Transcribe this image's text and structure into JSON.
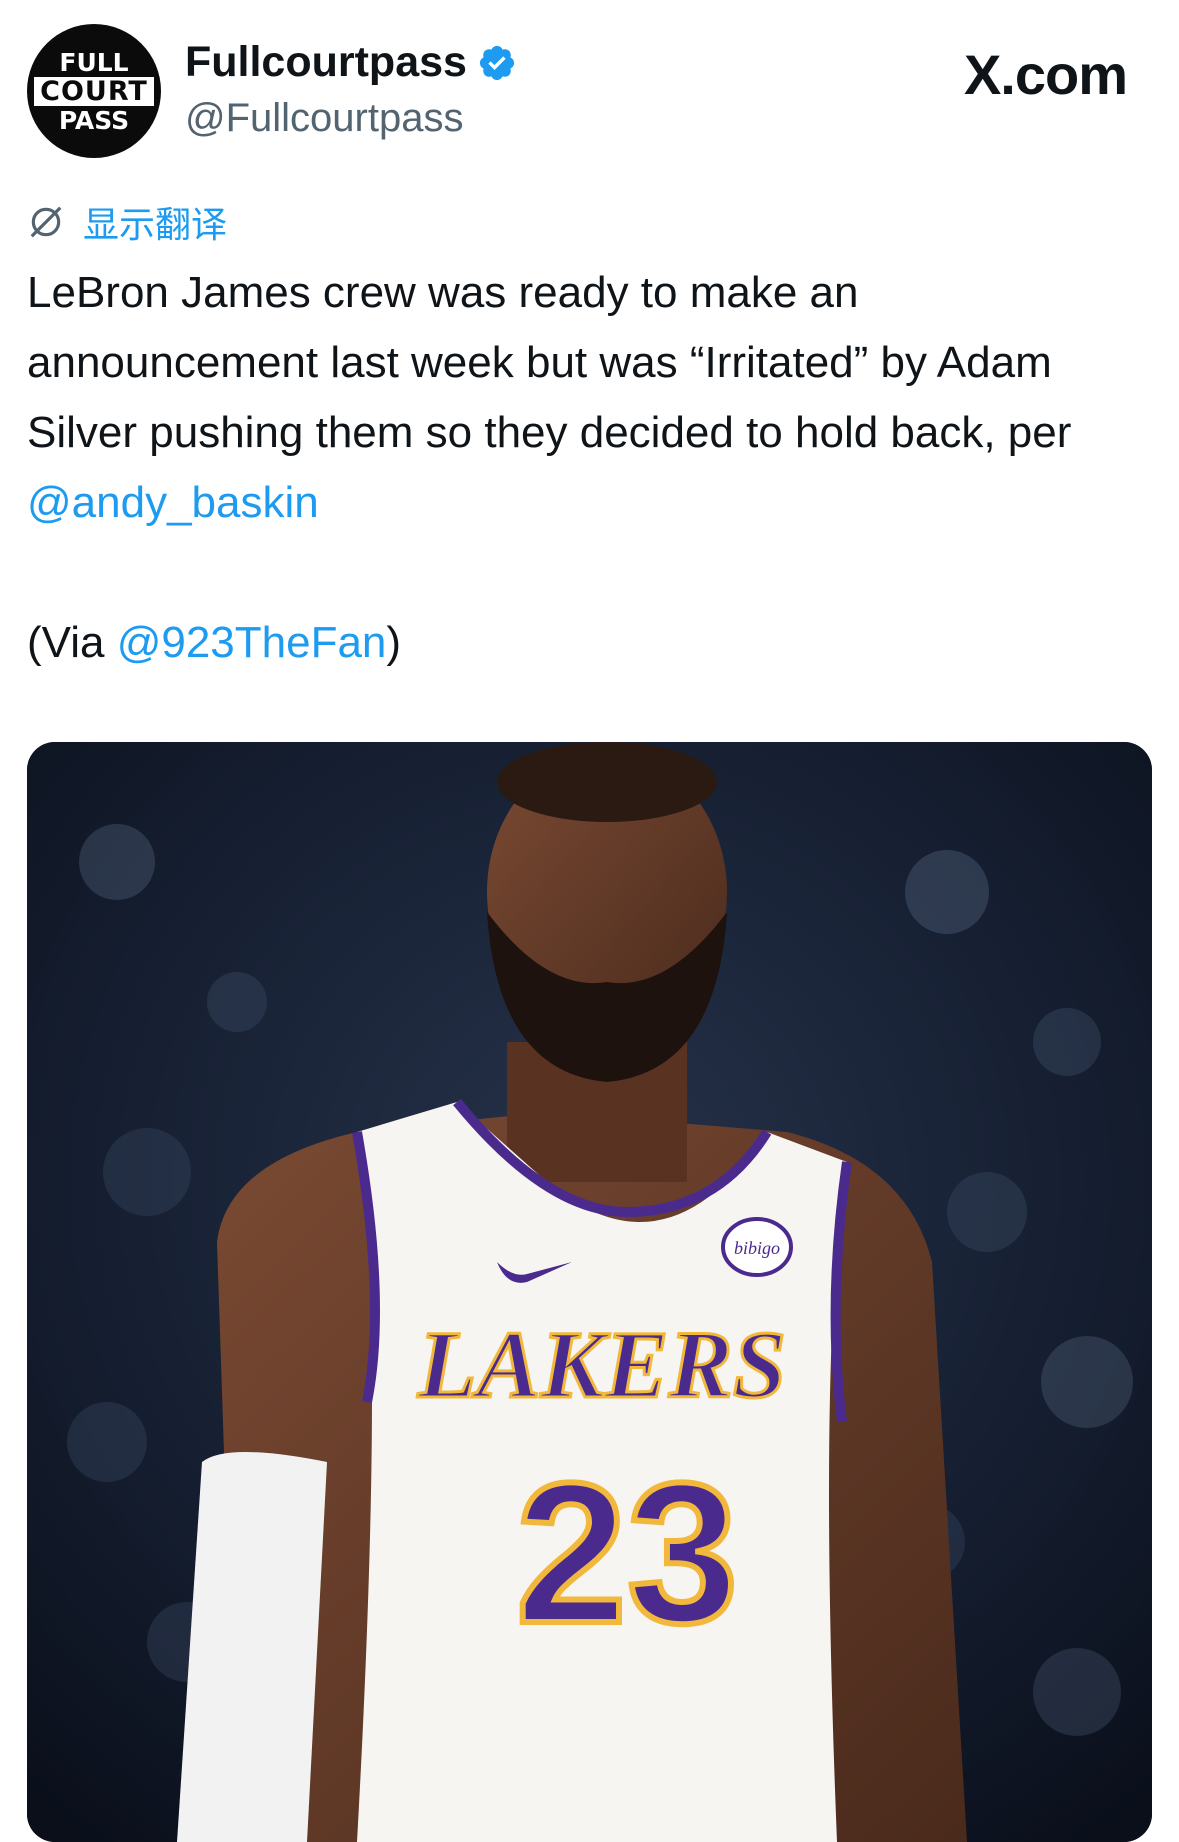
{
  "header": {
    "avatar_lines": [
      "FULL",
      "COURT",
      "PASS"
    ],
    "display_name": "Fullcourtpass",
    "handle": "@Fullcourtpass",
    "verified": true,
    "brand": "X.com"
  },
  "translate": {
    "icon": "no-translate-icon",
    "label": "显示翻译"
  },
  "tweet": {
    "line_before_mention": "LeBron James crew was ready to make an announcement last week but was “Irritated” by Adam Silver pushing them so they decided to hold back, per ",
    "mention_1": "@andy_baskin",
    "via_prefix": "(Via ",
    "mention_2": "@923TheFan",
    "via_suffix": ")"
  },
  "media": {
    "jersey_brand": "LAKERS",
    "jersey_number": "23",
    "sponsor_patch": "bibigo"
  },
  "colors": {
    "link": "#1d9bf0",
    "text": "#0f1419",
    "secondary": "#536471",
    "lakers_purple": "#4b2a8e",
    "lakers_gold": "#f2b83b"
  }
}
